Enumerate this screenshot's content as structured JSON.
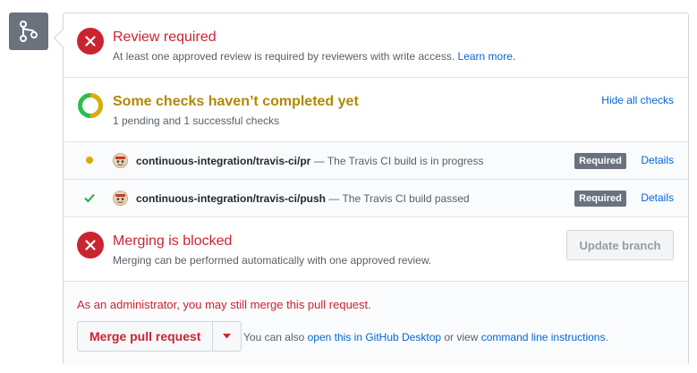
{
  "icons": {
    "branch": "git-branch-icon",
    "review_status": "x-circle-icon",
    "checks_status": "pending-ring-icon",
    "pending": "pending-dot-icon",
    "success": "check-icon",
    "travis": "travis-ci-icon",
    "blocked_status": "x-circle-icon",
    "caret": "triangle-down-icon"
  },
  "colors": {
    "error": "#cb2431",
    "pending": "#dbab09",
    "success": "#28a745",
    "link": "#0366d6",
    "label_bg": "#6a737d"
  },
  "review": {
    "title": "Review required",
    "description": "At least one approved review is required by reviewers with write access.",
    "learn_more": "Learn more."
  },
  "checks": {
    "title": "Some checks haven’t completed yet",
    "summary": "1 pending and 1 successful checks",
    "hide_all": "Hide all checks",
    "items": [
      {
        "context": "continuous-integration/travis-ci/pr",
        "separator": " — ",
        "description": "The Travis CI build is in progress",
        "label": "Required",
        "details": "Details",
        "status": "pending"
      },
      {
        "context": "continuous-integration/travis-ci/push",
        "separator": " — ",
        "description": "The Travis CI build passed",
        "label": "Required",
        "details": "Details",
        "status": "success"
      }
    ]
  },
  "blocked": {
    "title": "Merging is blocked",
    "description": "Merging can be performed automatically with one approved review.",
    "update_button": "Update branch"
  },
  "merge": {
    "admin_note": "As an administrator, you may still merge this pull request.",
    "merge_button": "Merge pull request",
    "also_prefix": "You can also ",
    "desktop_link": "open this in GitHub Desktop",
    "or_view": " or view ",
    "cli_link": "command line instructions",
    "period": "."
  }
}
